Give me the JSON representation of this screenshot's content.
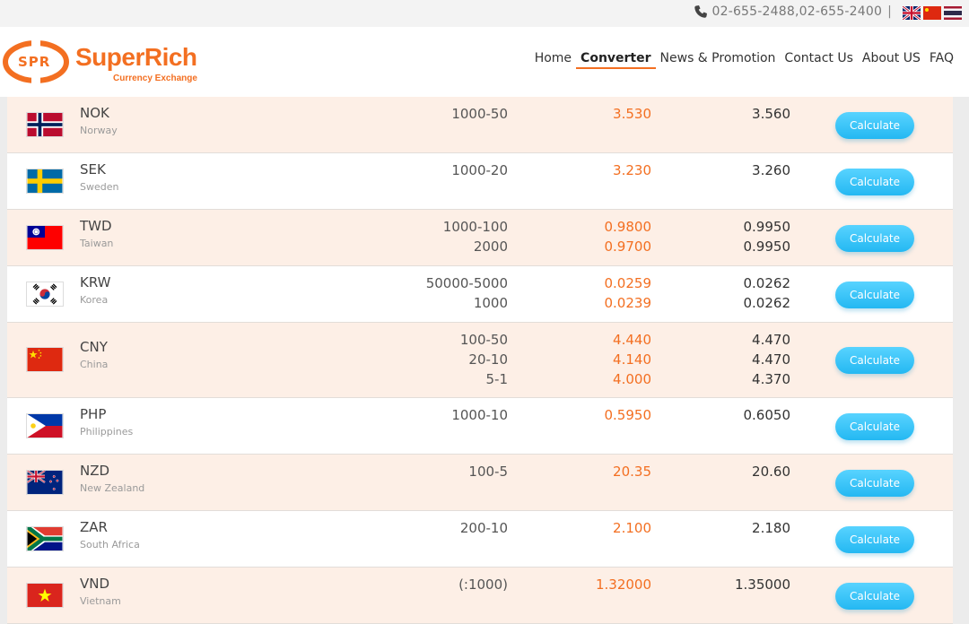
{
  "topbar": {
    "contact": "02-655-2488,02-655-2400",
    "separator": "|",
    "language_flags": [
      "uk-flag-icon",
      "china-flag-icon",
      "thailand-flag-icon"
    ]
  },
  "logo": {
    "mark": "SPR",
    "brand": "SuperRich",
    "sub": "Currency Exchange"
  },
  "nav": [
    {
      "label": "Home",
      "active": false
    },
    {
      "label": "Converter",
      "active": true
    },
    {
      "label": "News & Promotion",
      "active": false
    },
    {
      "label": "Contact Us",
      "active": false
    },
    {
      "label": "About US",
      "active": false
    },
    {
      "label": "FAQ",
      "active": false
    }
  ],
  "button_label": "Calculate",
  "colors": {
    "accent": "#f36f21",
    "button": "#2fbff5",
    "row_alt": "#fdefe6"
  },
  "rows": [
    {
      "code": "NOK",
      "country": "Norway",
      "flag": "norway-flag-icon",
      "denoms": [
        "1000-50"
      ],
      "buy": [
        "3.530"
      ],
      "sell": [
        "3.560"
      ]
    },
    {
      "code": "SEK",
      "country": "Sweden",
      "flag": "sweden-flag-icon",
      "denoms": [
        "1000-20"
      ],
      "buy": [
        "3.230"
      ],
      "sell": [
        "3.260"
      ]
    },
    {
      "code": "TWD",
      "country": "Taiwan",
      "flag": "taiwan-flag-icon",
      "denoms": [
        "1000-100",
        "2000"
      ],
      "buy": [
        "0.9800",
        "0.9700"
      ],
      "sell": [
        "0.9950",
        "0.9950"
      ]
    },
    {
      "code": "KRW",
      "country": "Korea",
      "flag": "korea-flag-icon",
      "denoms": [
        "50000-5000",
        "1000"
      ],
      "buy": [
        "0.0259",
        "0.0239"
      ],
      "sell": [
        "0.0262",
        "0.0262"
      ]
    },
    {
      "code": "CNY",
      "country": "China",
      "flag": "china-flag-icon",
      "denoms": [
        "100-50",
        "20-10",
        "5-1"
      ],
      "buy": [
        "4.440",
        "4.140",
        "4.000"
      ],
      "sell": [
        "4.470",
        "4.470",
        "4.370"
      ]
    },
    {
      "code": "PHP",
      "country": "Philippines",
      "flag": "philippines-flag-icon",
      "denoms": [
        "1000-10"
      ],
      "buy": [
        "0.5950"
      ],
      "sell": [
        "0.6050"
      ]
    },
    {
      "code": "NZD",
      "country": "New Zealand",
      "flag": "new-zealand-flag-icon",
      "denoms": [
        "100-5"
      ],
      "buy": [
        "20.35"
      ],
      "sell": [
        "20.60"
      ]
    },
    {
      "code": "ZAR",
      "country": "South Africa",
      "flag": "south-africa-flag-icon",
      "denoms": [
        "200-10"
      ],
      "buy": [
        "2.100"
      ],
      "sell": [
        "2.180"
      ]
    },
    {
      "code": "VND",
      "country": "Vietnam",
      "flag": "vietnam-flag-icon",
      "denoms": [
        "(:1000)"
      ],
      "buy": [
        "1.32000"
      ],
      "sell": [
        "1.35000"
      ]
    }
  ]
}
